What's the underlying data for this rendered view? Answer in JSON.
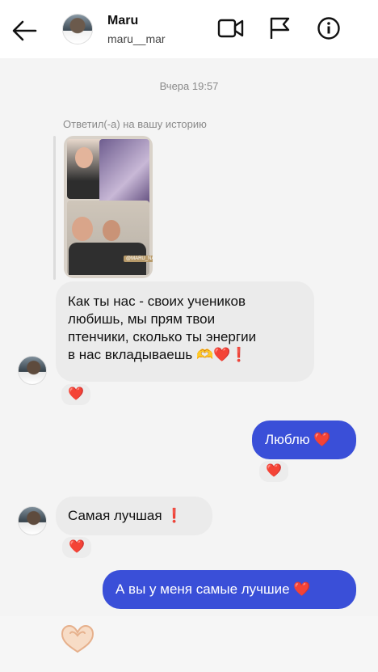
{
  "header": {
    "name": "Maru",
    "username": "maru__mar"
  },
  "thread": {
    "timestamp": "Вчера 19:57",
    "replied_label": "Ответил(-а) на вашу историю",
    "story_tag": "@МARU_NAILS"
  },
  "messages": [
    {
      "direction": "in",
      "lines": [
        "Как ты нас - своих учеников",
        "любишь, мы прям твои",
        "птенчики, сколько ты энергии",
        "в нас вкладываешь"
      ],
      "emoji": "🫶❤️❗",
      "reaction": "❤️"
    },
    {
      "direction": "out",
      "text": "Люблю",
      "emoji": "❤️",
      "reaction": "❤️"
    },
    {
      "direction": "in",
      "text": "Самая лучшая",
      "emoji": "❗",
      "reaction": "❤️"
    },
    {
      "direction": "out",
      "text": "А вы у меня самые лучшие",
      "emoji": "❤️"
    }
  ],
  "colors": {
    "outgoing_bubble": "#3a4fd8",
    "incoming_bubble": "#ebebeb",
    "heart": "#e3203b"
  }
}
